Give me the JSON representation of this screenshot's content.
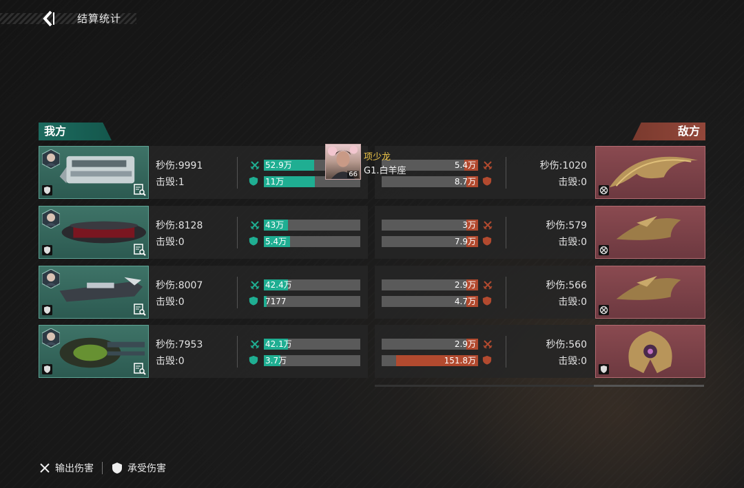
{
  "header": {
    "title": "结算统计"
  },
  "sides": {
    "ally": "我方",
    "enemy": "敌方"
  },
  "colors": {
    "ally": "#1fae92",
    "enemy": "#b24a2f"
  },
  "tooltip": {
    "name": "项少龙",
    "server": "G1.白羊座",
    "level": "66"
  },
  "allies": [
    {
      "dps": "秒伤:9991",
      "kills": "击毁:1",
      "damage_out": "52.9万",
      "damage_taken": "11万",
      "out_fraction": 0.52,
      "taken_fraction": 0.53
    },
    {
      "dps": "秒伤:8128",
      "kills": "击毁:0",
      "damage_out": "43万",
      "damage_taken": "5.4万",
      "out_fraction": 0.25,
      "taken_fraction": 0.27
    },
    {
      "dps": "秒伤:8007",
      "kills": "击毁:0",
      "damage_out": "42.4万",
      "damage_taken": "7177",
      "out_fraction": 0.25,
      "taken_fraction": 0.03
    },
    {
      "dps": "秒伤:7953",
      "kills": "击毁:0",
      "damage_out": "42.1万",
      "damage_taken": "3.7万",
      "out_fraction": 0.25,
      "taken_fraction": 0.17
    }
  ],
  "enemies": [
    {
      "dps": "秒伤:1020",
      "kills": "击毁:0",
      "damage_out": "5.4万",
      "damage_taken": "8.7万",
      "out_fraction": 0.14,
      "taken_fraction": 0.12
    },
    {
      "dps": "秒伤:579",
      "kills": "击毁:0",
      "damage_out": "3万",
      "damage_taken": "7.9万",
      "out_fraction": 0.12,
      "taken_fraction": 0.12
    },
    {
      "dps": "秒伤:566",
      "kills": "击毁:0",
      "damage_out": "2.9万",
      "damage_taken": "4.7万",
      "out_fraction": 0.12,
      "taken_fraction": 0.12
    },
    {
      "dps": "秒伤:560",
      "kills": "击毁:0",
      "damage_out": "2.9万",
      "damage_taken": "151.8万",
      "out_fraction": 0.12,
      "taken_fraction": 0.85
    }
  ],
  "legend": {
    "damage_out": "输出伤害",
    "damage_taken": "承受伤害"
  },
  "icons": {
    "back": "back-arrow-icon",
    "out": "crossed-swords-icon",
    "taken": "shield-icon",
    "detail": "detail-search-icon",
    "target": "target-icon"
  }
}
